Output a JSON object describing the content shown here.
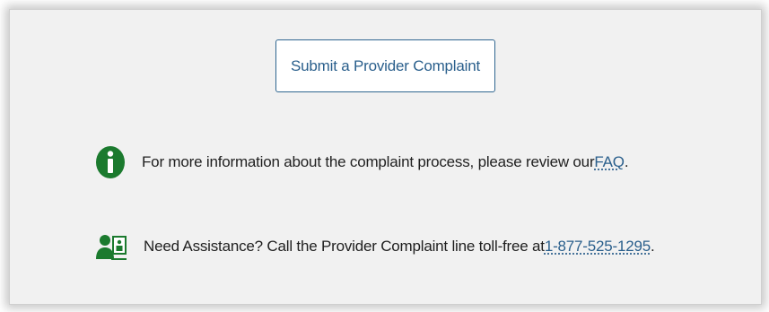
{
  "colors": {
    "accent": "#2a5f8c",
    "icon_green": "#1b7a2e",
    "panel_bg": "#f1f1f1"
  },
  "submit_button": {
    "label": "Submit a Provider Complaint"
  },
  "info": {
    "icon": "info-circle-icon",
    "text": "For more information about the complaint process, please review our ",
    "link_label": "FAQ",
    "suffix": "."
  },
  "assistance": {
    "icon": "contact-card-icon",
    "text": "Need Assistance? Call the Provider Complaint line toll-free at ",
    "phone": "1-877-525-1295",
    "suffix": "."
  }
}
